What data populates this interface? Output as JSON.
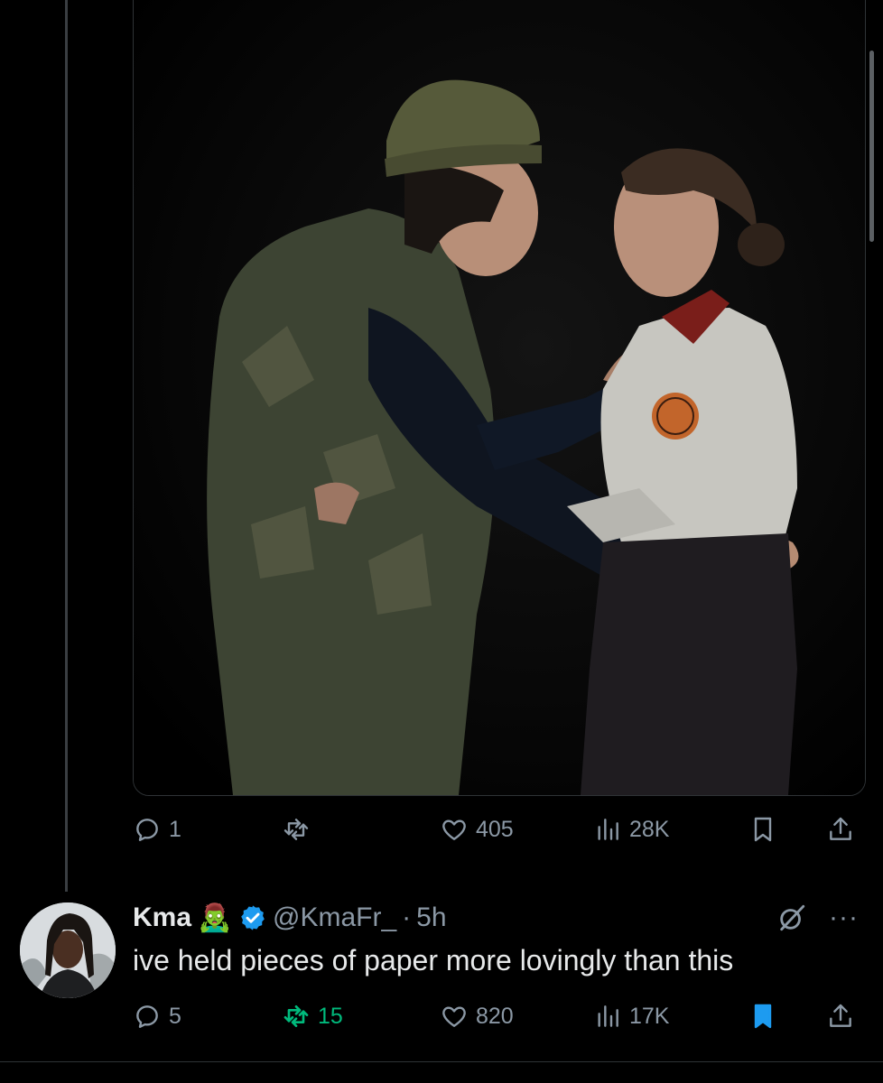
{
  "original_post": {
    "media_label": "photo",
    "reply_count": "1",
    "repost_count": "",
    "like_count": "405",
    "view_count": "28K"
  },
  "reply_post": {
    "display_name": "Kma",
    "name_emoji": "🧟‍♂️",
    "handle": "@KmaFr_",
    "separator": "·",
    "time": "5h",
    "text": "ive held pieces of paper more lovingly than this",
    "reply_count": "5",
    "repost_count": "15",
    "like_count": "820",
    "view_count": "17K",
    "reposted": true,
    "bookmarked": true
  },
  "icons": [
    "reply-icon",
    "repost-icon",
    "like-icon",
    "views-icon",
    "bookmark-icon",
    "share-icon",
    "verified-badge-icon",
    "grok-icon",
    "more-icon"
  ],
  "colors": {
    "background": "#000000",
    "muted": "#8b98a5",
    "accent": "#1d9bf0",
    "repost_active": "#00ba7c"
  }
}
